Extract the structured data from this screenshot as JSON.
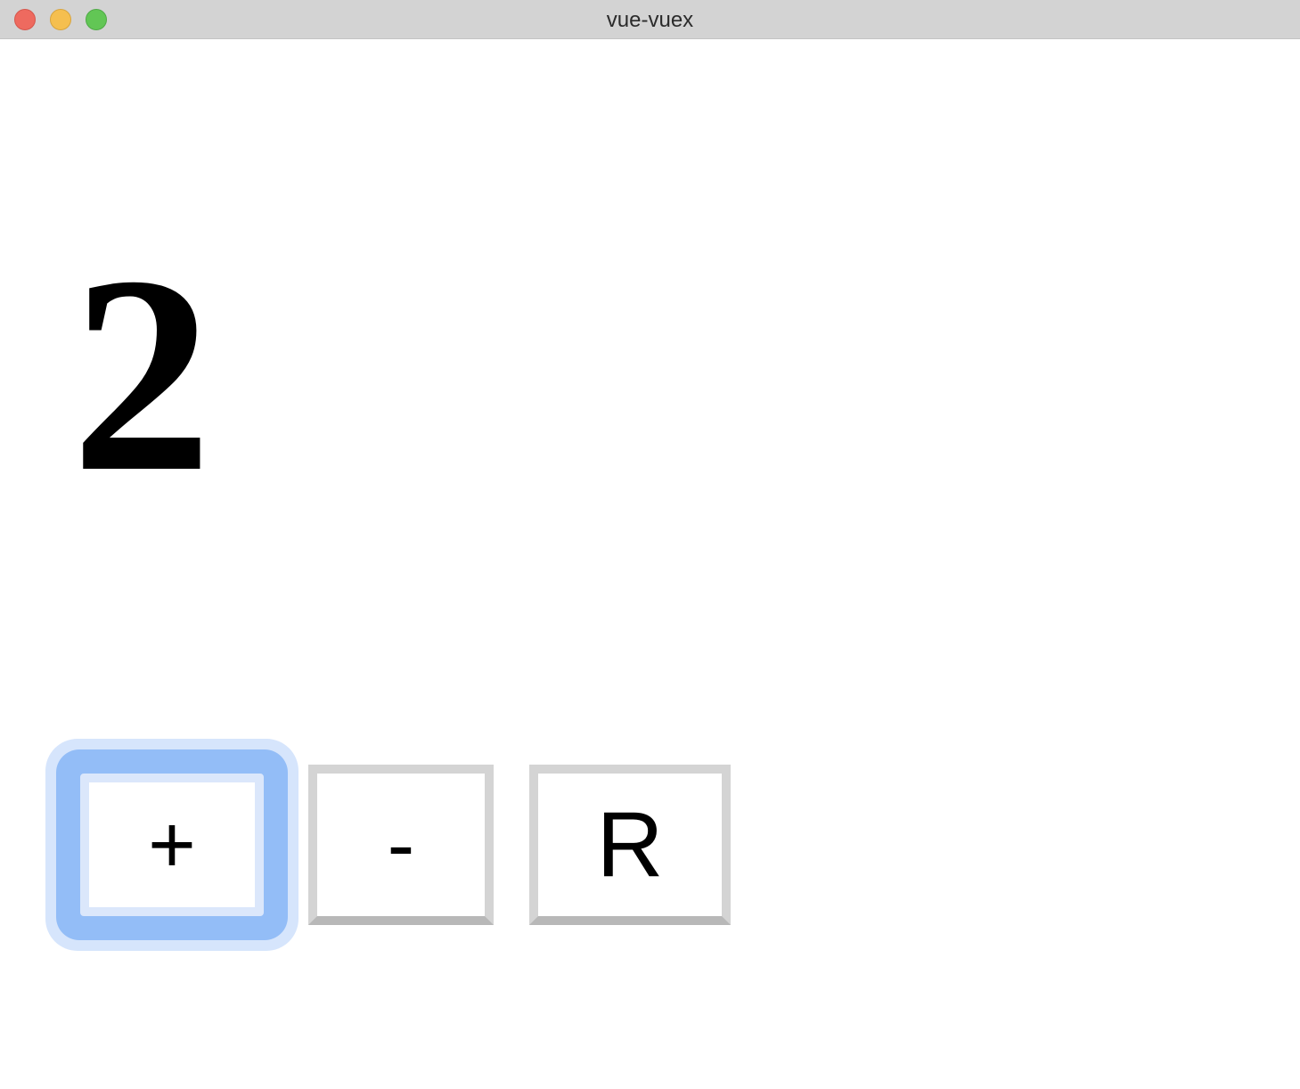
{
  "window": {
    "title": "vue-vuex"
  },
  "counter": {
    "value": "2"
  },
  "buttons": {
    "increment_label": "+",
    "decrement_label": "-",
    "reset_label": "R"
  }
}
